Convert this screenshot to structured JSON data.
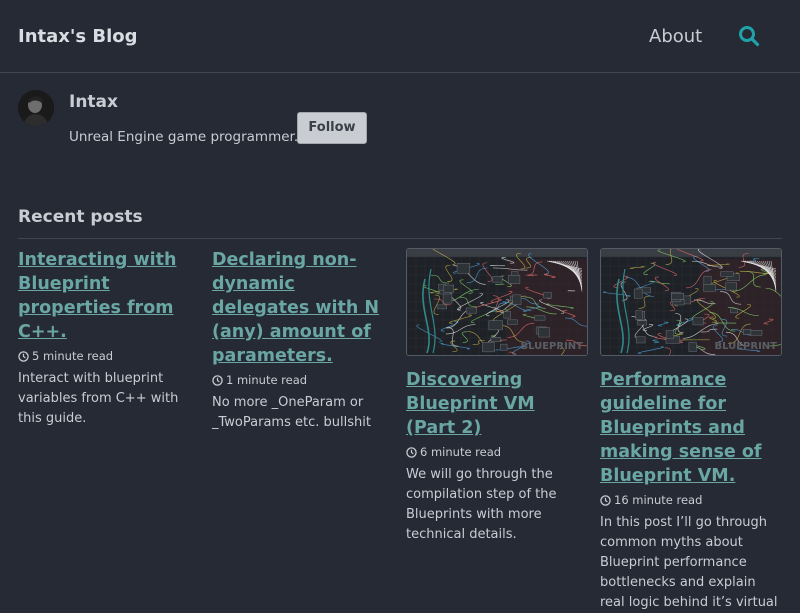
{
  "header": {
    "site_title": "Intax's Blog",
    "nav": {
      "about": "About"
    },
    "search_icon": "search-icon",
    "accent": "#1fa3a8"
  },
  "author": {
    "name": "Intax",
    "bio": "Unreal Engine game programmer.",
    "follow_label": "Follow"
  },
  "recent": {
    "title": "Recent posts",
    "posts": [
      {
        "title": "Interacting with Blueprint properties from C++.",
        "read_time": "5 minute read",
        "excerpt": "Interact with blueprint variables from C++ with this guide.",
        "has_thumb": false
      },
      {
        "title": "Declaring non-dynamic delegates with N (any) amount of parameters.",
        "read_time": "1 minute read",
        "excerpt": "No more _OneParam or _TwoParams etc. bullshit",
        "has_thumb": false
      },
      {
        "title": "Discovering Blueprint VM (Part 2)",
        "read_time": "6 minute read",
        "excerpt": "We will go through the compilation step of the Blueprints with more technical details.",
        "has_thumb": true,
        "thumb_watermark": "BLUEPRINT"
      },
      {
        "title": "Performance guideline for Blueprints and making sense of Blueprint VM.",
        "read_time": "16 minute read",
        "excerpt": "In this post I’ll go through common myths about Blueprint performance bottlenecks and explain real logic behind it’s virtual",
        "has_thumb": true,
        "thumb_watermark": "BLUEPRINT"
      }
    ]
  },
  "colors": {
    "background": "#252a34",
    "text": "#c8cdd4",
    "link": "#6aa6a3"
  }
}
